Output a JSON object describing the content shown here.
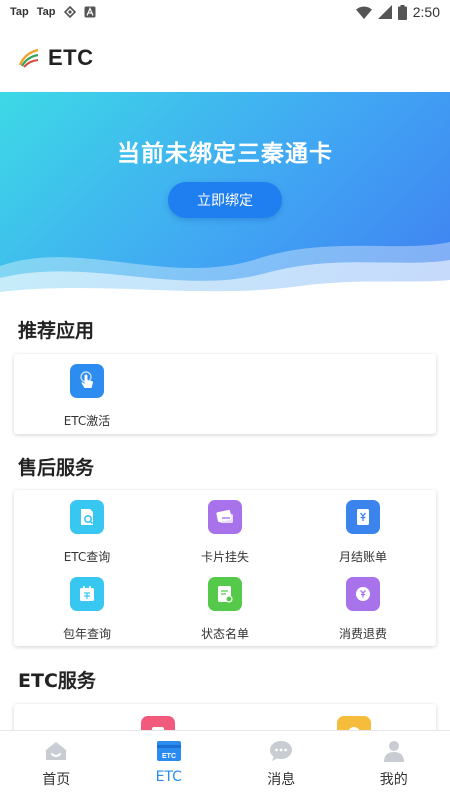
{
  "status_bar": {
    "notifications": [
      "Tap",
      "Tap"
    ],
    "time": "2:50"
  },
  "header": {
    "title": "ETC"
  },
  "banner": {
    "title": "当前未绑定三秦通卡",
    "bind_label": "立即绑定"
  },
  "recommended": {
    "title": "推荐应用",
    "items": [
      {
        "label": "ETC激活",
        "icon": "tap-hand-icon",
        "color": "#2d8cf0"
      }
    ]
  },
  "after_sales": {
    "title": "售后服务",
    "items": [
      {
        "label": "ETC查询",
        "icon": "document-search-icon",
        "color": "#38c7f0"
      },
      {
        "label": "卡片挂失",
        "icon": "card-loss-icon",
        "color": "#a873ea"
      },
      {
        "label": "月结账单",
        "icon": "monthly-bill-icon",
        "color": "#3b84ee"
      },
      {
        "label": "包年查询",
        "icon": "annual-calendar-icon",
        "color": "#38c7f0"
      },
      {
        "label": "状态名单",
        "icon": "status-list-icon",
        "color": "#55c94a"
      },
      {
        "label": "消费退费",
        "icon": "refund-icon",
        "color": "#a873ea"
      }
    ]
  },
  "etc_services": {
    "title": "ETC服务"
  },
  "bottom_nav": {
    "items": [
      {
        "label": "首页",
        "icon": "home-icon"
      },
      {
        "label": "ETC",
        "icon": "etc-card-icon",
        "active": true
      },
      {
        "label": "消息",
        "icon": "message-icon"
      },
      {
        "label": "我的",
        "icon": "profile-icon"
      }
    ]
  }
}
